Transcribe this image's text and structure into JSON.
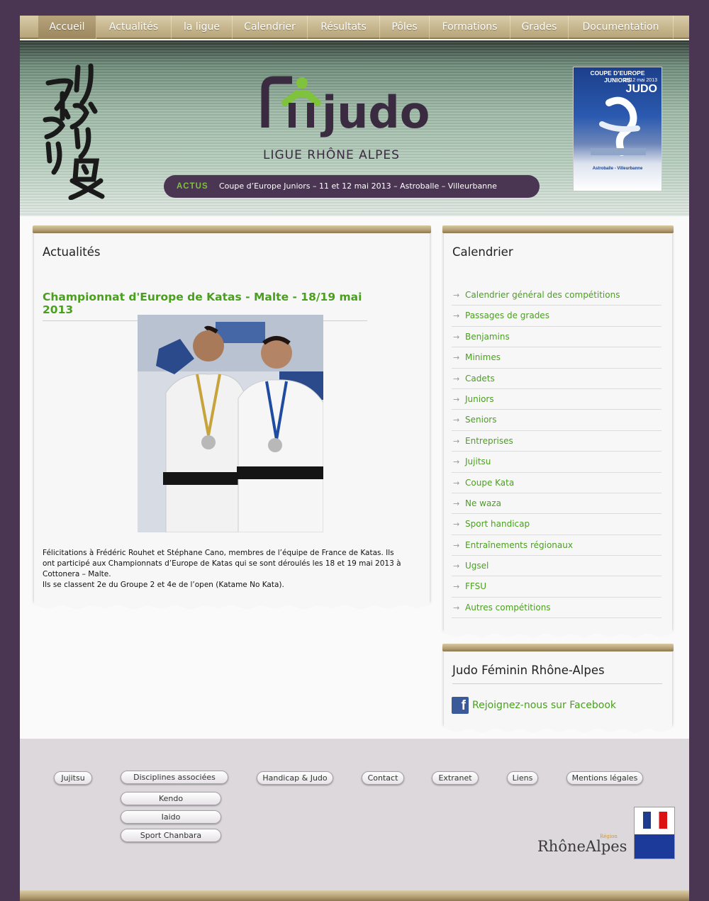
{
  "nav": [
    "Accueil",
    "Actualités",
    "la ligue",
    "Calendrier",
    "Résultats",
    "Pôles",
    "Formations",
    "Grades",
    "Documentation"
  ],
  "header": {
    "logo_text": "LIGUE RHÔNE ALPES",
    "logo_word": "judo",
    "actus_label": "ACTUS",
    "actus_text": "Coupe d’Europe Juniors – 11 et 12 mai 2013 – Astroballe – Villeurbanne",
    "poster": {
      "title": "COUPE D’EUROPE JUNIORS",
      "dates": "11/12 mai 2013",
      "sport": "JUDO",
      "venue": "Astroballe - Villeurbanne"
    }
  },
  "actualites": {
    "heading": "Actualités",
    "article_title": "Championnat d'Europe de Katas - Malte - 18/19 mai 2013",
    "body_lines": [
      "Félicitations à Frédéric Rouhet et Stéphane Cano, membres de l’équipe de France de Katas. Ils",
      "ont participé aux Championnats d’Europe de Katas qui se sont déroulés les 18 et 19 mai 2013 à",
      "Cottonera – Malte.",
      "Ils se classent 2e du Groupe 2 et 4e de l’open (Katame No Kata)."
    ]
  },
  "calendrier": {
    "heading": "Calendrier",
    "items": [
      "Calendrier général des compétitions",
      "Passages de grades",
      "Benjamins",
      "Minimes",
      "Cadets",
      "Juniors",
      "Seniors",
      "Entreprises",
      "Jujitsu",
      "Coupe Kata",
      "Ne waza",
      "Sport handicap",
      "Entraînements régionaux",
      "Ugsel",
      "FFSU",
      "Autres compétitions"
    ]
  },
  "judo_feminin": {
    "heading": "Judo Féminin Rhône-Alpes",
    "link": "Rejoignez-nous sur Facebook"
  },
  "footer": {
    "links": [
      "Jujitsu",
      "Disciplines associées",
      "Handicap & Judo",
      "Contact",
      "Extranet",
      "Liens",
      "Mentions légales"
    ],
    "sub_links": [
      "Kendo",
      "Iaido",
      "Sport Chanbara"
    ],
    "region": "RhôneAlpes",
    "region_small": "Région"
  }
}
